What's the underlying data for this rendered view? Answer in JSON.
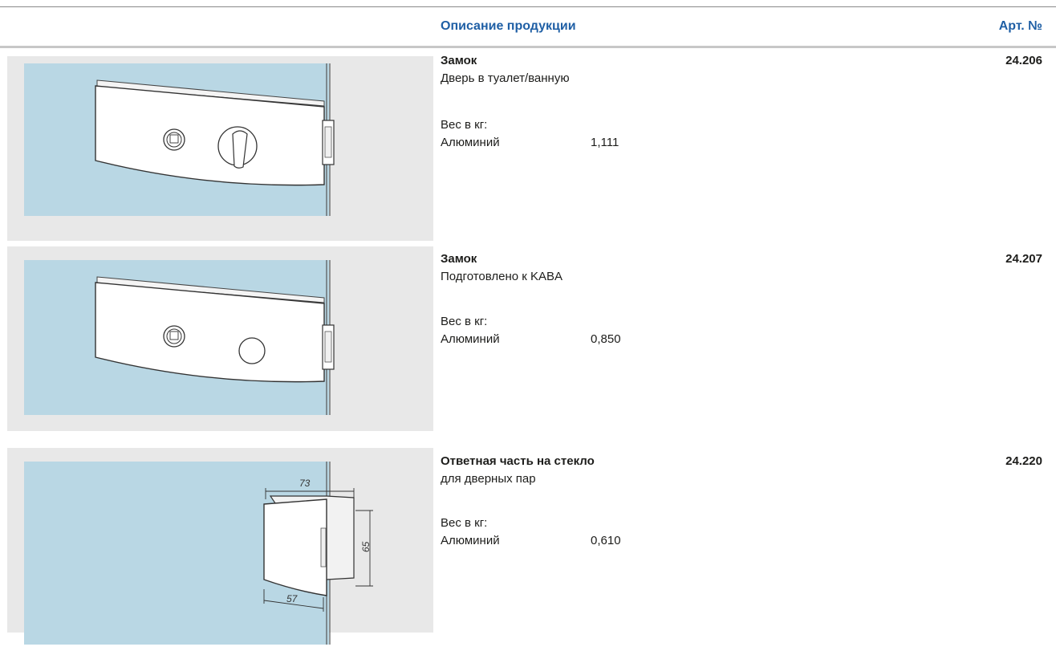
{
  "header": {
    "description_label": "Описание продукции",
    "article_label": "Арт. №"
  },
  "products": [
    {
      "title": "Замок",
      "subtitle": "Дверь в туалет/ванную",
      "weight_label": "Вес в кг:",
      "material": "Алюминий",
      "weight": "1,111",
      "article": "24.206"
    },
    {
      "title": "Замок",
      "subtitle": "Подготовлено к KABA",
      "weight_label": "Вес в кг:",
      "material": "Алюминий",
      "weight": "0,850",
      "article": "24.207"
    },
    {
      "title": "Ответная часть на стекло",
      "subtitle": "для дверных пар",
      "weight_label": "Вес в кг:",
      "material": "Алюминий",
      "weight": "0,610",
      "article": "24.220",
      "dimensions": {
        "width": "73",
        "height": "65",
        "depth": "57"
      }
    }
  ],
  "colors": {
    "accent": "#1f5fa5",
    "glass": "#b9d7e4",
    "panel": "#e8e8e8"
  }
}
